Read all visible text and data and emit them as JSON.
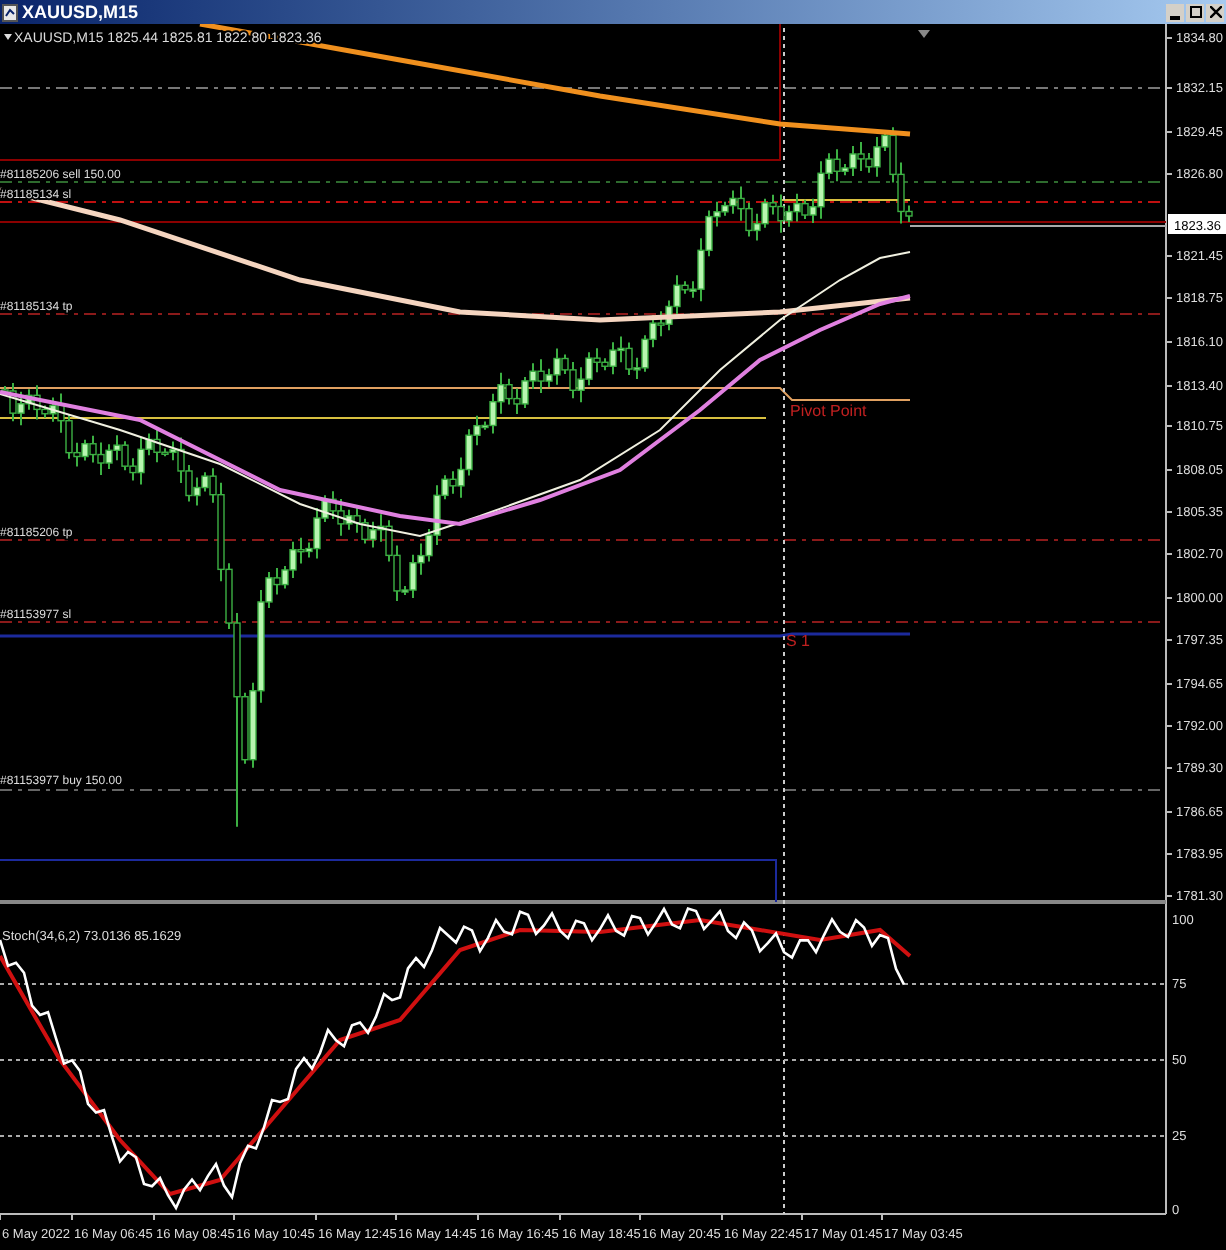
{
  "window": {
    "title": "XAUUSD,M15"
  },
  "chart": {
    "header": "XAUUSD,M15  1825.44 1825.81 1822.80 1823.36",
    "price_labels": [
      "1834.80",
      "1832.15",
      "1829.45",
      "1826.80",
      "1821.45",
      "1818.75",
      "1816.10",
      "1813.40",
      "1810.75",
      "1808.05",
      "1805.35",
      "1802.70",
      "1800.00",
      "1797.35",
      "1794.65",
      "1792.00",
      "1789.30",
      "1786.65",
      "1783.95",
      "1781.30"
    ],
    "current_price": "1823.36",
    "order_labels": [
      "#81185206 sell 150.00",
      "#81185134 sl",
      "#81185134 tp",
      "#81185206 tp",
      "#81153977 sl",
      "#81153977 buy 150.00"
    ],
    "level_labels": [
      "Pivot Point",
      "S 1"
    ],
    "time_labels": [
      "6 May 2022",
      "16 May 06:45",
      "16 May 08:45",
      "16 May 10:45",
      "16 May 12:45",
      "16 May 14:45",
      "16 May 16:45",
      "16 May 18:45",
      "16 May 20:45",
      "16 May 22:45",
      "17 May 01:45",
      "17 May 03:45"
    ]
  },
  "indicator": {
    "label": "Stoch(34,6,2) 73.0136 85.1629",
    "scale_labels": [
      "100",
      "75",
      "50",
      "25",
      "0"
    ]
  }
}
